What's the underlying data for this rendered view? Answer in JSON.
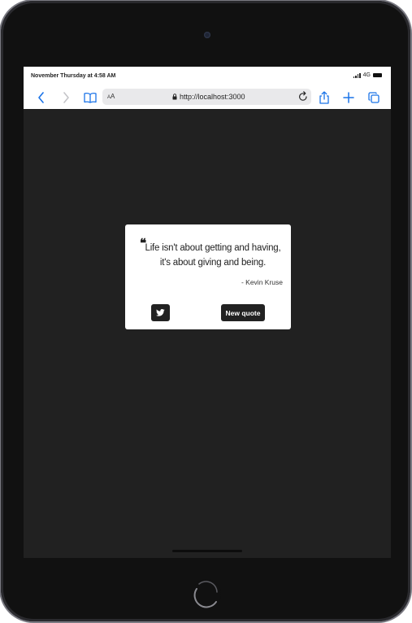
{
  "status_bar": {
    "time": "November Thursday at 4:58 AM",
    "network": "4G"
  },
  "browser": {
    "text_size_label": "AA",
    "url": "http://localhost:3000"
  },
  "quote_card": {
    "quote_mark": "❝",
    "text": "Life isn't about getting and having, it's about giving and being.",
    "author": "- Kevin Kruse",
    "new_quote_label": "New quote",
    "twitter_icon": "twitter-icon"
  },
  "colors": {
    "page_background": "#212121",
    "card_background": "#ffffff",
    "button_background": "#222222",
    "browser_accent": "#1a73e8"
  }
}
